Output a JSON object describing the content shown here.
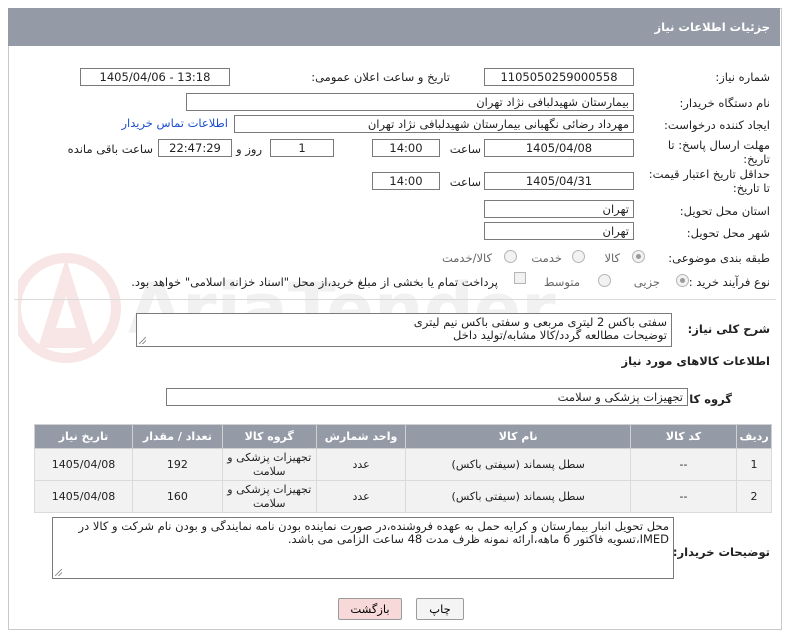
{
  "header": {
    "title": "جزئیات اطلاعات نیاز"
  },
  "form": {
    "need_number": {
      "label": "شماره نیاز:",
      "value": "1105050259000558"
    },
    "announce_datetime": {
      "label": "تاریخ و ساعت اعلان عمومی:",
      "value": "1405/04/06 - 13:18"
    },
    "buyer_org": {
      "label": "نام دستگاه خریدار:",
      "value": "بیمارستان شهیدلبافی نژاد تهران"
    },
    "requester": {
      "label": "ایجاد کننده درخواست:",
      "value": "مهرداد رضائی نگهبانی بیمارستان شهیدلبافی نژاد تهران",
      "contact_link": "اطلاعات تماس خریدار"
    },
    "reply_deadline": {
      "label_line1": "مهلت ارسال پاسخ: تا",
      "label_line2": "تاریخ:",
      "date": "1405/04/08",
      "time_label": "ساعت",
      "time": "14:00",
      "days": "1",
      "days_label": "روز و",
      "remaining": "22:47:29",
      "remaining_label": "ساعت باقی مانده"
    },
    "price_validity": {
      "label_line1": "حداقل تاریخ اعتبار قیمت:",
      "label_line2": "تا تاریخ:",
      "date": "1405/04/31",
      "time_label": "ساعت",
      "time": "14:00"
    },
    "delivery_province": {
      "label": "استان محل تحویل:",
      "value": "تهران"
    },
    "delivery_city": {
      "label": "شهر محل تحویل:",
      "value": "تهران"
    },
    "category": {
      "label": "طبقه بندی موضوعی:",
      "options": [
        "کالا",
        "خدمت",
        "کالا/خدمت"
      ],
      "selected": "کالا"
    },
    "process_type": {
      "label": "نوع فرآیند خرید :",
      "options": [
        "جزیی",
        "متوسط"
      ],
      "selected": "جزیی",
      "payment_note": "پرداخت تمام یا بخشی از مبلغ خرید،از محل \"اسناد خزانه اسلامی\" خواهد بود."
    }
  },
  "description": {
    "label": "شرح کلی نیاز:",
    "line1": "سفتی باکس 2 لیتری مربعی و سفتی باکس نیم لیتری",
    "line2": "توضیحات مطالعه گردد/کالا مشابه/تولید داخل"
  },
  "goods": {
    "section_title": "اطلاعات کالاهای مورد نیاز",
    "group_label": "گروه کالا:",
    "group_value": "تجهیزات پزشکی و سلامت",
    "columns": [
      "ردیف",
      "کد کالا",
      "نام کالا",
      "واحد شمارش",
      "گروه کالا",
      "تعداد / مقدار",
      "تاریخ نیاز"
    ],
    "rows": [
      {
        "row": "1",
        "code": "--",
        "name": "سطل پسماند (سیفتی باکس)",
        "unit": "عدد",
        "group": "تجهیزات پزشکی و سلامت",
        "qty": "192",
        "date": "1405/04/08"
      },
      {
        "row": "2",
        "code": "--",
        "name": "سطل پسماند (سیفتی باکس)",
        "unit": "عدد",
        "group": "تجهیزات پزشکی و سلامت",
        "qty": "160",
        "date": "1405/04/08"
      }
    ]
  },
  "buyer_notes": {
    "label": "توضیحات خریدار:",
    "line1": "محل تحویل انبار بیمارستان و کرایه حمل به عهده فروشنده،در صورت نماینده بودن نامه نمایندگی و بودن نام شرکت و کالا در",
    "line2": "IMED،تسویه فاکتور 6 ماهه،ارائه نمونه ظرف مدت 48 ساعت الزامی می باشد."
  },
  "buttons": {
    "print": "چاپ",
    "back": "بازگشت"
  },
  "watermark": {
    "text": "AriaTender.net"
  },
  "colors": {
    "header_bg": "#949aa6",
    "link": "#1a4fd0",
    "back_button_bg": "#f7d9d9"
  }
}
